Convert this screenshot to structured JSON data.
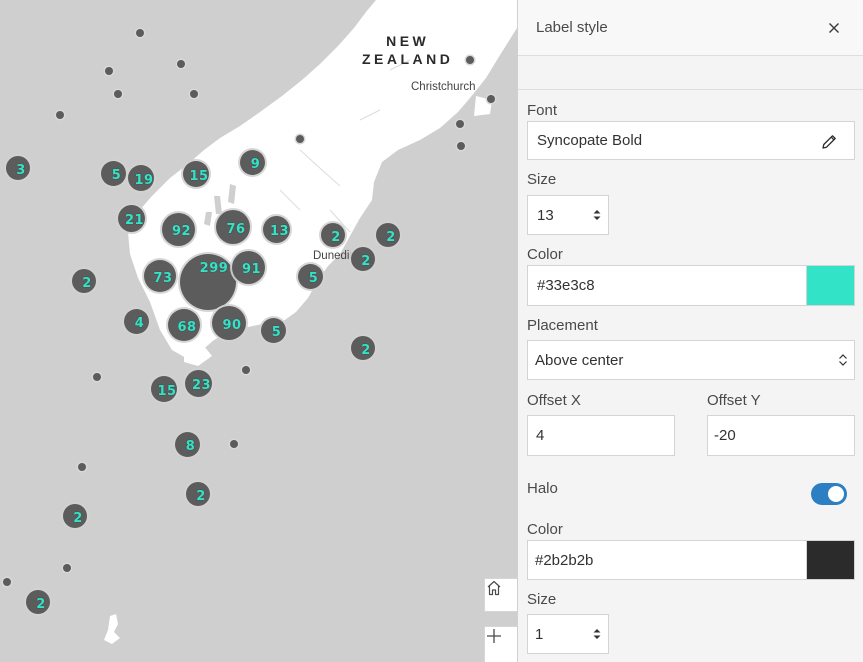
{
  "map": {
    "country_label_line1": "NEW",
    "country_label_line2": "ZEALAND",
    "city_christchurch": "Christchurch",
    "city_dunedin": "Dunedin",
    "clusters": [
      "3",
      "5",
      "19",
      "15",
      "9",
      "21",
      "92",
      "76",
      "13",
      "2",
      "2",
      "73",
      "299",
      "91",
      "2",
      "5",
      "2",
      "4",
      "68",
      "90",
      "5",
      "2",
      "15",
      "23",
      "8",
      "2",
      "2",
      "2"
    ]
  },
  "panel": {
    "title": "Label style",
    "font_label": "Font",
    "font_value": "Syncopate Bold",
    "size_label": "Size",
    "size_value": "13",
    "color_label": "Color",
    "color_value": "#33e3c8",
    "placement_label": "Placement",
    "placement_value": "Above center",
    "offset_x_label": "Offset X",
    "offset_x_value": "4",
    "offset_y_label": "Offset Y",
    "offset_y_value": "-20",
    "halo_label": "Halo",
    "halo_on": true,
    "halo_color_label": "Color",
    "halo_color_value": "#2b2b2b",
    "halo_size_label": "Size",
    "halo_size_value": "1"
  },
  "colors": {
    "label_color": "#33e3c8",
    "halo_color": "#2b2b2b",
    "accent": "#2b7fc2"
  },
  "icons": [
    "close-icon",
    "pencil-icon",
    "spinner-arrows-icon",
    "select-arrows-icon",
    "home-icon",
    "plus-icon"
  ]
}
